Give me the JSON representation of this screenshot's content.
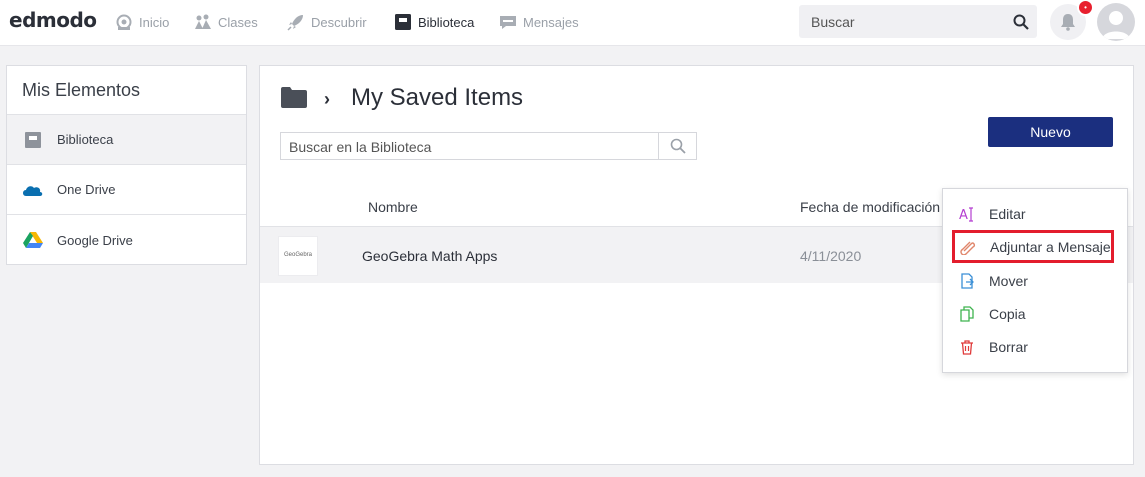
{
  "app": {
    "logo": "edmodo"
  },
  "nav": [
    {
      "label": "Inicio",
      "icon": "home-icon"
    },
    {
      "label": "Clases",
      "icon": "classes-icon"
    },
    {
      "label": "Descubrir",
      "icon": "rocket-icon"
    },
    {
      "label": "Biblioteca",
      "icon": "library-icon",
      "active": true
    },
    {
      "label": "Mensajes",
      "icon": "messages-icon"
    }
  ],
  "search": {
    "placeholder": "Buscar"
  },
  "notifications": {
    "badge": "•"
  },
  "sidebar": {
    "title": "Mis Elementos",
    "items": [
      {
        "label": "Biblioteca",
        "icon": "library-icon",
        "active": true
      },
      {
        "label": "One Drive",
        "icon": "onedrive-icon"
      },
      {
        "label": "Google Drive",
        "icon": "google-drive-icon"
      }
    ]
  },
  "main": {
    "title": "My Saved Items",
    "search_placeholder": "Buscar en la Biblioteca",
    "new_label": "Nuevo",
    "columns": {
      "name": "Nombre",
      "date": "Fecha de modificación"
    },
    "rows": [
      {
        "thumb": "GeoGebra",
        "name": "GeoGebra Math Apps",
        "date": "4/11/2020"
      }
    ]
  },
  "menu": {
    "items": [
      {
        "label": "Editar",
        "icon": "edit-icon",
        "color": "#b43fd0"
      },
      {
        "label": "Adjuntar a Mensaje",
        "icon": "paperclip-icon",
        "color": "#e0866b",
        "highlighted": true
      },
      {
        "label": "Mover",
        "icon": "move-icon",
        "color": "#3a8fd6"
      },
      {
        "label": "Copia",
        "icon": "copy-icon",
        "color": "#3fb34f"
      },
      {
        "label": "Borrar",
        "icon": "trash-icon",
        "color": "#e03a3a"
      }
    ]
  },
  "colors": {
    "accent": "#1b2f7f",
    "highlight_border": "#e31d2d"
  }
}
